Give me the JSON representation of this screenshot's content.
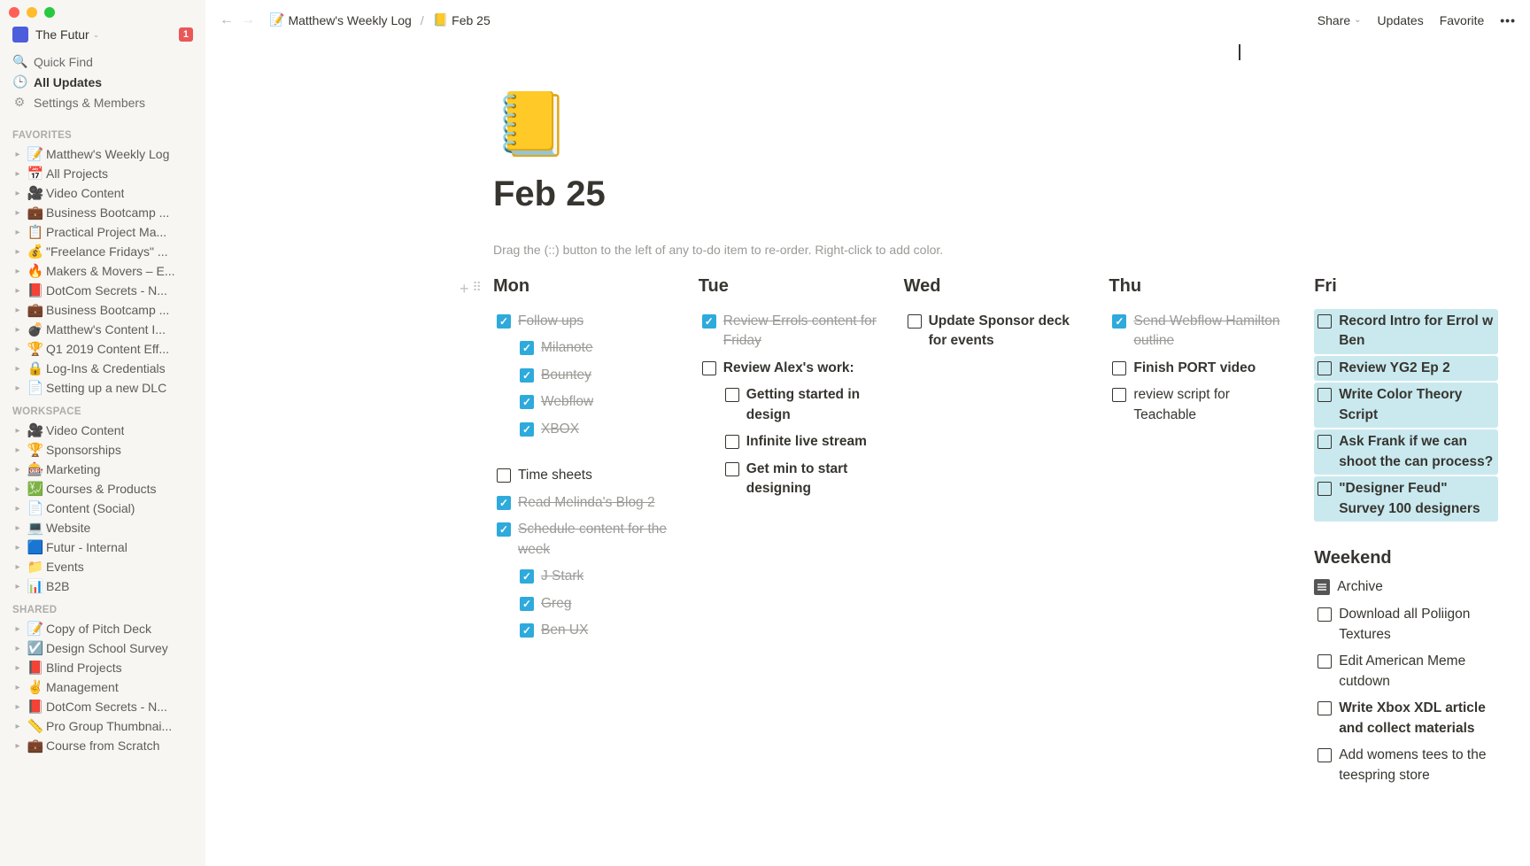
{
  "workspace": {
    "name": "The Futur",
    "badge": "1"
  },
  "sidebar_utils": {
    "quick_find": "Quick Find",
    "all_updates": "All Updates",
    "settings": "Settings & Members"
  },
  "sections": {
    "favorites": "FAVORITES",
    "workspace": "WORKSPACE",
    "shared": "SHARED"
  },
  "favorites": [
    {
      "emoji": "📝",
      "title": "Matthew's Weekly Log"
    },
    {
      "emoji": "📅",
      "title": "All Projects"
    },
    {
      "emoji": "🎥",
      "title": "Video Content"
    },
    {
      "emoji": "💼",
      "title": "Business Bootcamp ..."
    },
    {
      "emoji": "📋",
      "title": "Practical Project Ma..."
    },
    {
      "emoji": "💰",
      "title": "\"Freelance Fridays\" ..."
    },
    {
      "emoji": "🔥",
      "title": "Makers & Movers – E..."
    },
    {
      "emoji": "📕",
      "title": "DotCom Secrets - N..."
    },
    {
      "emoji": "💼",
      "title": "Business Bootcamp ..."
    },
    {
      "emoji": "💣",
      "title": "Matthew's Content I..."
    },
    {
      "emoji": "🏆",
      "title": "Q1 2019 Content Eff..."
    },
    {
      "emoji": "🔒",
      "title": "Log-Ins & Credentials"
    },
    {
      "emoji": "📄",
      "title": "Setting up a new DLC"
    }
  ],
  "workspace_pages": [
    {
      "emoji": "🎥",
      "title": "Video Content"
    },
    {
      "emoji": "🏆",
      "title": "Sponsorships"
    },
    {
      "emoji": "🎰",
      "title": "Marketing"
    },
    {
      "emoji": "💹",
      "title": "Courses & Products"
    },
    {
      "emoji": "📄",
      "title": "Content (Social)"
    },
    {
      "emoji": "💻",
      "title": "Website"
    },
    {
      "emoji": "🟦",
      "title": "Futur - Internal"
    },
    {
      "emoji": "📁",
      "title": "Events"
    },
    {
      "emoji": "📊",
      "title": "B2B"
    }
  ],
  "shared_pages": [
    {
      "emoji": "📝",
      "title": "Copy of Pitch Deck"
    },
    {
      "emoji": "☑️",
      "title": "Design School Survey"
    },
    {
      "emoji": "📕",
      "title": "Blind Projects"
    },
    {
      "emoji": "✌️",
      "title": "Management"
    },
    {
      "emoji": "📕",
      "title": "DotCom Secrets - N..."
    },
    {
      "emoji": "📏",
      "title": "Pro Group Thumbnai..."
    },
    {
      "emoji": "💼",
      "title": "Course from Scratch"
    }
  ],
  "breadcrumb": {
    "parent_emoji": "📝",
    "parent_label": "Matthew's Weekly Log",
    "current_emoji": "📒",
    "current_label": "Feb 25"
  },
  "topbar_actions": {
    "share": "Share",
    "updates": "Updates",
    "favorite": "Favorite"
  },
  "page_icon": "📒",
  "page_title": "Feb 25",
  "hint": "Drag the (::) button to the left of any to-do item to re-order. Right-click to add color.",
  "days": {
    "mon": "Mon",
    "tue": "Tue",
    "wed": "Wed",
    "thu": "Thu",
    "fri": "Fri"
  },
  "mon_items": [
    {
      "text": "Follow ups",
      "checked": true,
      "indent": 0
    },
    {
      "text": "Milanote",
      "checked": true,
      "indent": 1
    },
    {
      "text": "Bountey",
      "checked": true,
      "indent": 1
    },
    {
      "text": "Webflow",
      "checked": true,
      "indent": 1
    },
    {
      "text": "XBOX",
      "checked": true,
      "indent": 1
    }
  ],
  "mon_items2": [
    {
      "text": "Time sheets",
      "checked": false,
      "indent": 0
    },
    {
      "text": "Read Melinda's Blog 2",
      "checked": true,
      "indent": 0
    },
    {
      "text": "Schedule content for the week",
      "checked": true,
      "indent": 0
    },
    {
      "text": "J Stark",
      "checked": true,
      "indent": 1
    },
    {
      "text": "Greg",
      "checked": true,
      "indent": 1
    },
    {
      "text": "Ben UX",
      "checked": true,
      "indent": 1
    }
  ],
  "tue_items": [
    {
      "text": "Review Errols content for Friday",
      "checked": true,
      "indent": 0
    },
    {
      "text": "Review Alex's work:",
      "checked": false,
      "indent": 0,
      "bold": true
    },
    {
      "text": "Getting started in design",
      "checked": false,
      "indent": 1,
      "bold": true
    },
    {
      "text": "Infinite live stream",
      "checked": false,
      "indent": 1,
      "bold": true
    },
    {
      "text": "Get min to start designing",
      "checked": false,
      "indent": 1,
      "bold": true
    }
  ],
  "wed_items": [
    {
      "text": "Update Sponsor deck for events",
      "checked": false,
      "indent": 0,
      "bold": true
    }
  ],
  "thu_items": [
    {
      "text": "Send Webflow Hamilton outline",
      "checked": true,
      "indent": 0
    },
    {
      "text": "Finish PORT video",
      "checked": false,
      "indent": 0,
      "bold": true
    },
    {
      "text": "review script for Teachable",
      "checked": false,
      "indent": 0
    }
  ],
  "fri_items": [
    {
      "text": "Record Intro for Errol w Ben",
      "checked": false,
      "indent": 0,
      "highlight": true,
      "bold": true
    },
    {
      "text": "Review YG2 Ep 2",
      "checked": false,
      "indent": 0,
      "highlight": true,
      "bold": true
    },
    {
      "text": "Write Color Theory Script",
      "checked": false,
      "indent": 0,
      "highlight": true,
      "bold": true
    },
    {
      "text": "Ask Frank if we can shoot the can process?",
      "checked": false,
      "indent": 0,
      "highlight": true,
      "bold": true
    },
    {
      "text": "\"Designer Feud\" Survey 100 designers",
      "checked": false,
      "indent": 0,
      "highlight": true,
      "bold": true
    }
  ],
  "weekend_label": "Weekend",
  "archive_label": "Archive",
  "weekend_items": [
    {
      "text": "Download all Poliigon Textures",
      "checked": false
    },
    {
      "text": "Edit American Meme cutdown",
      "checked": false
    },
    {
      "text": "Write Xbox XDL article and collect materials",
      "checked": false,
      "bold": true
    },
    {
      "text": "Add womens tees to the teespring store",
      "checked": false
    }
  ]
}
